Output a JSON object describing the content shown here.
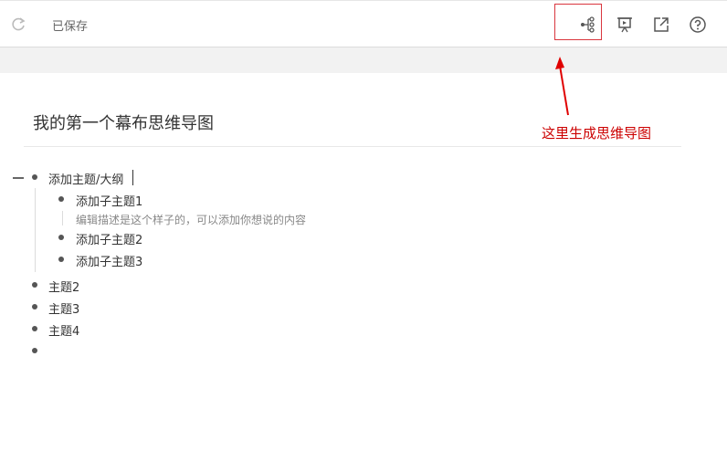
{
  "toolbar": {
    "saved_label": "已保存",
    "icons": [
      "redo-icon",
      "mindmap-icon",
      "presentation-icon",
      "export-icon",
      "help-icon"
    ]
  },
  "document": {
    "title": "我的第一个幕布思维导图"
  },
  "annotation": {
    "text": "这里生成思维导图",
    "color": "#cc0000"
  },
  "outline": {
    "root": {
      "label": "添加主题/大纲",
      "children": [
        {
          "label": "添加子主题1",
          "note": "编辑描述是这个样子的，可以添加你想说的内容"
        },
        {
          "label": "添加子主题2"
        },
        {
          "label": "添加子主题3"
        }
      ]
    },
    "topics": [
      "主题2",
      "主题3",
      "主题4"
    ]
  },
  "colors": {
    "accent_red": "#d9363e",
    "band_grey": "#f2f2f2"
  }
}
